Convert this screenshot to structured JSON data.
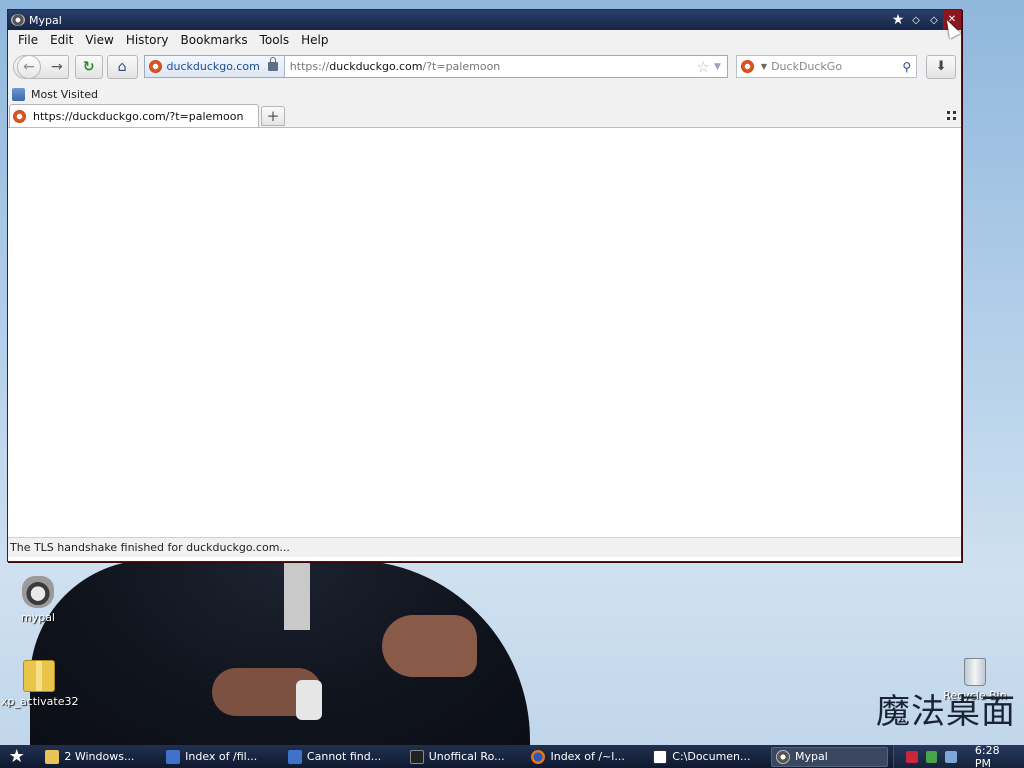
{
  "window": {
    "title": "Mypal",
    "title_controls": [
      "pin-icon",
      "restore-icon",
      "maximize-icon",
      "close-icon"
    ]
  },
  "menubar": [
    "File",
    "Edit",
    "View",
    "History",
    "Bookmarks",
    "Tools",
    "Help"
  ],
  "navbar": {
    "identity_label": "duckduckgo.com",
    "url_prefix": "https://",
    "url_host": "duckduckgo.com",
    "url_suffix": "/?t=palemoon",
    "search_placeholder": "DuckDuckGo"
  },
  "bookmarks": {
    "most_visited": "Most Visited"
  },
  "tabs": [
    {
      "label": "https://duckduckgo.com/?t=palemoon"
    }
  ],
  "status": "The TLS handshake finished for duckduckgo.com...",
  "desktop": {
    "icons": [
      {
        "label": "mypal"
      },
      {
        "label": "xp_activate32"
      },
      {
        "label": "Recycle Bin"
      }
    ],
    "logo_text": "魔法桌面"
  },
  "taskbar": {
    "items": [
      {
        "label": "2 Windows...",
        "icon": "folder-icon"
      },
      {
        "label": "Index of /fil...",
        "icon": "ie-icon"
      },
      {
        "label": "Cannot find...",
        "icon": "ie-icon"
      },
      {
        "label": "Unoffical Ro...",
        "icon": "console-icon"
      },
      {
        "label": "Index of /~l...",
        "icon": "firefox-icon"
      },
      {
        "label": "C:\\Documen...",
        "icon": "7zip-icon"
      },
      {
        "label": "Mypal",
        "icon": "mypal-icon",
        "active": true
      }
    ],
    "clock": "6:28 PM"
  },
  "colors": {
    "titlebar": "#152545",
    "window_border": "#6b0f16",
    "taskbar": "#0f1a30"
  }
}
